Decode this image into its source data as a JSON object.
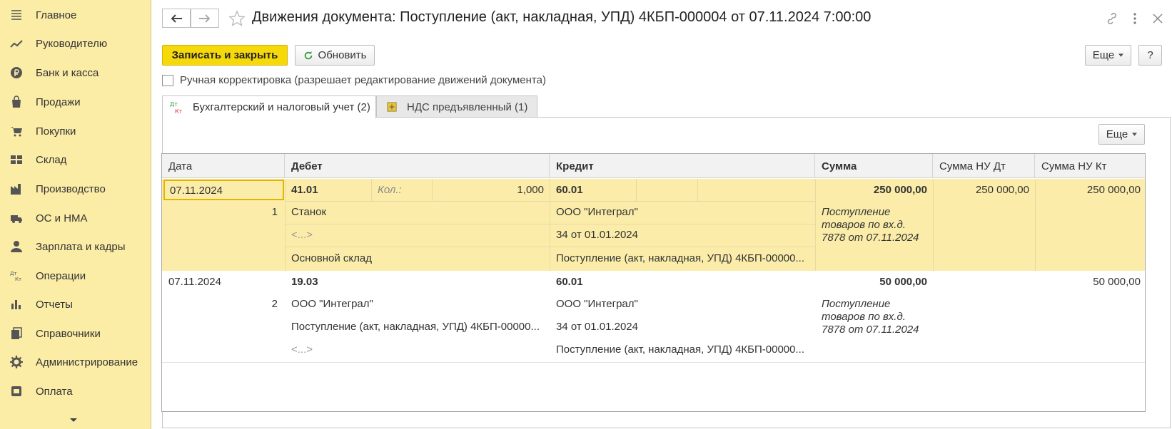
{
  "sidebar": {
    "items": [
      {
        "label": "Главное",
        "icon": "menu-icon"
      },
      {
        "label": "Руководителю",
        "icon": "trend-icon"
      },
      {
        "label": "Банк и касса",
        "icon": "ruble-icon"
      },
      {
        "label": "Продажи",
        "icon": "bag-icon"
      },
      {
        "label": "Покупки",
        "icon": "cart-icon"
      },
      {
        "label": "Склад",
        "icon": "warehouse-icon"
      },
      {
        "label": "Производство",
        "icon": "factory-icon"
      },
      {
        "label": "ОС и НМА",
        "icon": "truck-icon"
      },
      {
        "label": "Зарплата и кадры",
        "icon": "person-icon"
      },
      {
        "label": "Операции",
        "icon": "dt-kt-icon"
      },
      {
        "label": "Отчеты",
        "icon": "bar-chart-icon"
      },
      {
        "label": "Справочники",
        "icon": "books-icon"
      },
      {
        "label": "Администрирование",
        "icon": "gear-icon"
      },
      {
        "label": "Оплата",
        "icon": "payment-icon"
      }
    ]
  },
  "header": {
    "title": "Движения документа: Поступление (акт, накладная, УПД) 4КБП-000004 от 07.11.2024 7:00:00"
  },
  "toolbar": {
    "save_close": "Записать и закрыть",
    "refresh": "Обновить",
    "more": "Еще",
    "help": "?"
  },
  "checkbox": {
    "label": "Ручная корректировка (разрешает редактирование движений документа)"
  },
  "tabs": [
    {
      "label": "Бухгалтерский и налоговый учет (2)",
      "icon_text": "Дт Кт"
    },
    {
      "label": "НДС предъявленный (1)"
    }
  ],
  "panel": {
    "more": "Еще"
  },
  "table": {
    "headers": [
      "Дата",
      "Дебет",
      "Кредит",
      "Сумма",
      "Сумма НУ Дт",
      "Сумма НУ Кт"
    ],
    "records": [
      {
        "date": "07.11.2024",
        "num": "1",
        "debit_account": "41.01",
        "qty_label": "Кол.:",
        "qty": "1,000",
        "debit_sub1": "Станок",
        "debit_sub2": "<...>",
        "debit_sub3": "Основной склад",
        "credit_account": "60.01",
        "credit_sub1": "ООО \"Интеграл\"",
        "credit_sub2": "34 от 01.01.2024",
        "credit_sub3": "Поступление (акт, накладная, УПД) 4КБП-00000...",
        "sum": "250 000,00",
        "content": "Поступление товаров по вх.д. 7878 от 07.11.2024",
        "content_lines": [
          "Поступление",
          "товаров по вх.д.",
          "7878 от 07.11.2024"
        ],
        "nu_dt": "250 000,00",
        "nu_kt": "250 000,00"
      },
      {
        "date": "07.11.2024",
        "num": "2",
        "debit_account": "19.03",
        "debit_sub1": "ООО \"Интеграл\"",
        "debit_sub2": "Поступление (акт, накладная, УПД) 4КБП-00000...",
        "debit_sub3": "<...>",
        "credit_account": "60.01",
        "credit_sub1": "ООО \"Интеграл\"",
        "credit_sub2": "34 от 01.01.2024",
        "credit_sub3": "Поступление (акт, накладная, УПД) 4КБП-00000...",
        "sum": "50 000,00",
        "content_lines": [
          "Поступление",
          "товаров по вх.д.",
          "7878 от 07.11.2024"
        ],
        "nu_dt": "",
        "nu_kt": "50 000,00"
      }
    ]
  },
  "colors": {
    "sidebar_bg": "#fbeca6",
    "primary_button": "#f6d90b",
    "selected_row": "#fbeda9"
  }
}
